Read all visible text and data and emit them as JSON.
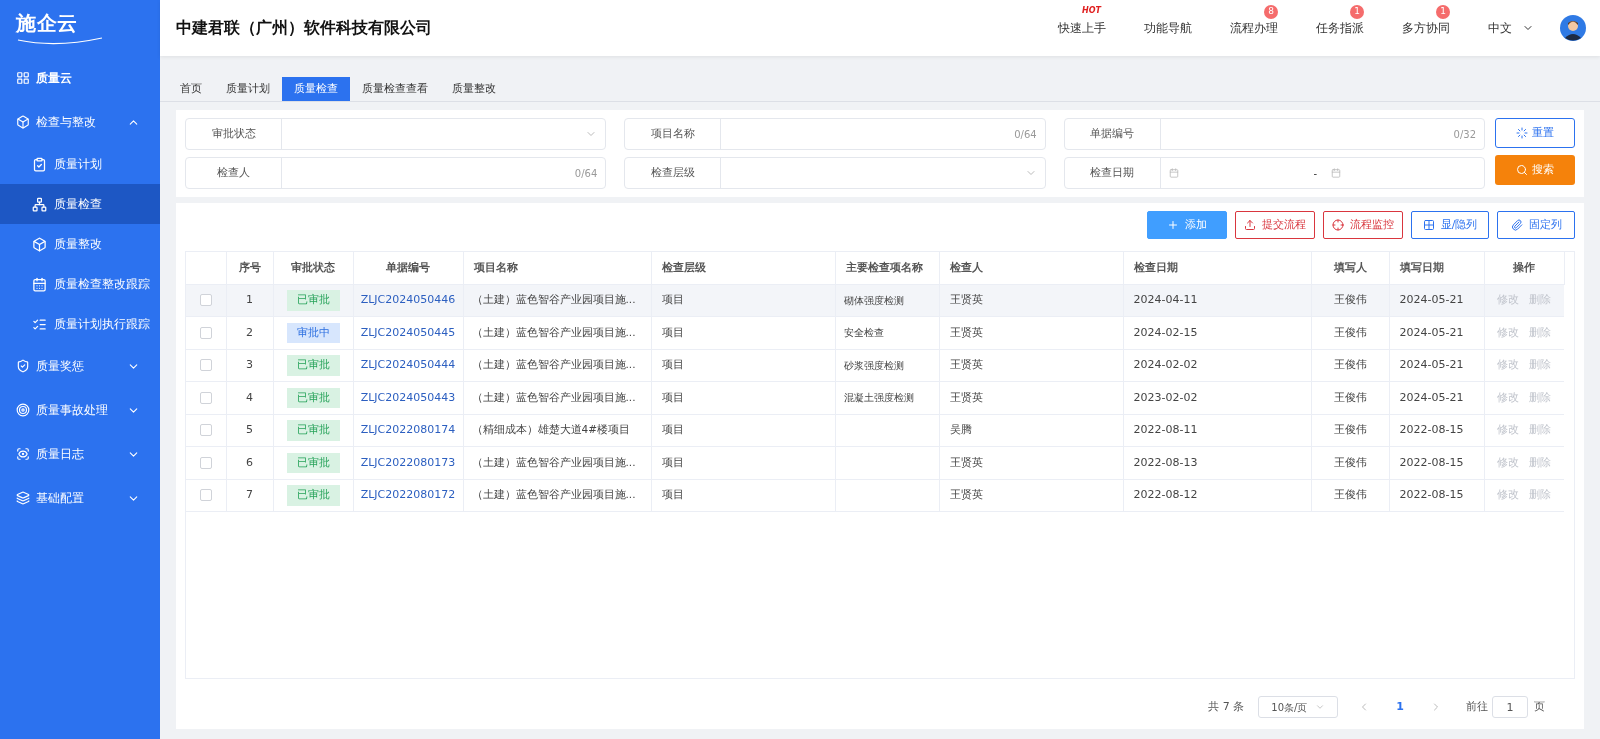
{
  "logo": {
    "text": "施企云"
  },
  "sidebar": {
    "items": [
      {
        "label": "质量云",
        "selected": false
      },
      {
        "label": "检查与整改",
        "expanded": true,
        "selected": false,
        "children": [
          {
            "label": "质量计划",
            "selected": false
          },
          {
            "label": "质量检查",
            "selected": true
          },
          {
            "label": "质量整改",
            "selected": false
          },
          {
            "label": "质量检查整改跟踪",
            "selected": false
          },
          {
            "label": "质量计划执行跟踪",
            "selected": false
          }
        ]
      },
      {
        "label": "质量奖惩",
        "expanded": false,
        "selected": false
      },
      {
        "label": "质量事故处理",
        "expanded": false,
        "selected": false
      },
      {
        "label": "质量日志",
        "expanded": false,
        "selected": false
      },
      {
        "label": "基础配置",
        "expanded": false,
        "selected": false
      }
    ]
  },
  "header": {
    "company": "中建君联（广州）软件科技有限公司",
    "nav": [
      {
        "label": "快速上手",
        "tag": "HOT"
      },
      {
        "label": "功能导航"
      },
      {
        "label": "流程办理",
        "badge": "8"
      },
      {
        "label": "任务指派",
        "badge": "1"
      },
      {
        "label": "多方协同",
        "badge": "1"
      }
    ],
    "language": "中文"
  },
  "tabs": [
    {
      "label": "首页",
      "selected": false
    },
    {
      "label": "质量计划",
      "selected": false
    },
    {
      "label": "质量检查",
      "selected": true
    },
    {
      "label": "质量检查查看",
      "selected": false
    },
    {
      "label": "质量整改",
      "selected": false
    }
  ],
  "filters": [
    {
      "label": "审批状态",
      "kind": "select"
    },
    {
      "label": "项目名称",
      "kind": "text",
      "count": "0/64"
    },
    {
      "label": "单据编号",
      "kind": "text",
      "count": "0/32"
    },
    {
      "label": "检查人",
      "kind": "text",
      "count": "0/64"
    },
    {
      "label": "检查层级",
      "kind": "select"
    },
    {
      "label": "检查日期",
      "kind": "daterange",
      "separator": "-"
    }
  ],
  "filter_buttons": [
    {
      "label": "重置",
      "kind": "reset"
    },
    {
      "label": "搜索",
      "kind": "search"
    }
  ],
  "toolbar": [
    {
      "label": "添加",
      "kind": "add"
    },
    {
      "label": "提交流程",
      "kind": "submit"
    },
    {
      "label": "流程监控",
      "kind": "monitor"
    },
    {
      "label": "显/隐列",
      "kind": "columns"
    },
    {
      "label": "固定列",
      "kind": "pin"
    }
  ],
  "table": {
    "columns": [
      "序号",
      "审批状态",
      "单据编号",
      "项目名称",
      "检查层级",
      "主要检查项名称",
      "检查人",
      "检查日期",
      "填写人",
      "填写日期",
      "操作"
    ],
    "rows": [
      {
        "checked": false,
        "highlighted": true,
        "index": "1",
        "status": {
          "label": "已审批",
          "kind": "approved"
        },
        "number": "ZLJC2024050446",
        "project": "（土建）蓝色智谷产业园项目施...",
        "level": "项目",
        "item": "砌体强度检测",
        "inspector": "王贤英",
        "date": "2024-04-11",
        "filler": "王俊伟",
        "fill_date": "2024-05-21",
        "actions": [
          "修改",
          "删除"
        ]
      },
      {
        "checked": false,
        "highlighted": false,
        "index": "2",
        "status": {
          "label": "审批中",
          "kind": "pending"
        },
        "number": "ZLJC2024050445",
        "project": "（土建）蓝色智谷产业园项目施...",
        "level": "项目",
        "item": "安全检查",
        "inspector": "王贤英",
        "date": "2024-02-15",
        "filler": "王俊伟",
        "fill_date": "2024-05-21",
        "actions": [
          "修改",
          "删除"
        ]
      },
      {
        "checked": false,
        "highlighted": false,
        "index": "3",
        "status": {
          "label": "已审批",
          "kind": "approved"
        },
        "number": "ZLJC2024050444",
        "project": "（土建）蓝色智谷产业园项目施...",
        "level": "项目",
        "item": "砂浆强度检测",
        "inspector": "王贤英",
        "date": "2024-02-02",
        "filler": "王俊伟",
        "fill_date": "2024-05-21",
        "actions": [
          "修改",
          "删除"
        ]
      },
      {
        "checked": false,
        "highlighted": false,
        "index": "4",
        "status": {
          "label": "已审批",
          "kind": "approved"
        },
        "number": "ZLJC2024050443",
        "project": "（土建）蓝色智谷产业园项目施...",
        "level": "项目",
        "item": "混凝土强度检测",
        "inspector": "王贤英",
        "date": "2023-02-02",
        "filler": "王俊伟",
        "fill_date": "2024-05-21",
        "actions": [
          "修改",
          "删除"
        ]
      },
      {
        "checked": false,
        "highlighted": false,
        "index": "5",
        "status": {
          "label": "已审批",
          "kind": "approved"
        },
        "number": "ZLJC2022080174",
        "project": "（精细成本）雄楚大道4#楼项目",
        "level": "项目",
        "item": "",
        "inspector": "吴腾",
        "date": "2022-08-11",
        "filler": "王俊伟",
        "fill_date": "2022-08-15",
        "actions": [
          "修改",
          "删除"
        ]
      },
      {
        "checked": false,
        "highlighted": false,
        "index": "6",
        "status": {
          "label": "已审批",
          "kind": "approved"
        },
        "number": "ZLJC2022080173",
        "project": "（土建）蓝色智谷产业园项目施...",
        "level": "项目",
        "item": "",
        "inspector": "王贤英",
        "date": "2022-08-13",
        "filler": "王俊伟",
        "fill_date": "2022-08-15",
        "actions": [
          "修改",
          "删除"
        ]
      },
      {
        "checked": false,
        "highlighted": false,
        "index": "7",
        "status": {
          "label": "已审批",
          "kind": "approved"
        },
        "number": "ZLJC2022080172",
        "project": "（土建）蓝色智谷产业园项目施...",
        "level": "项目",
        "item": "",
        "inspector": "王贤英",
        "date": "2022-08-12",
        "filler": "王俊伟",
        "fill_date": "2022-08-15",
        "actions": [
          "修改",
          "删除"
        ]
      }
    ]
  },
  "pagination": {
    "total": "共 7 条",
    "page_size": "10条/页",
    "current": "1",
    "goto_label": "前往",
    "goto_value": "1",
    "page_unit": "页"
  }
}
